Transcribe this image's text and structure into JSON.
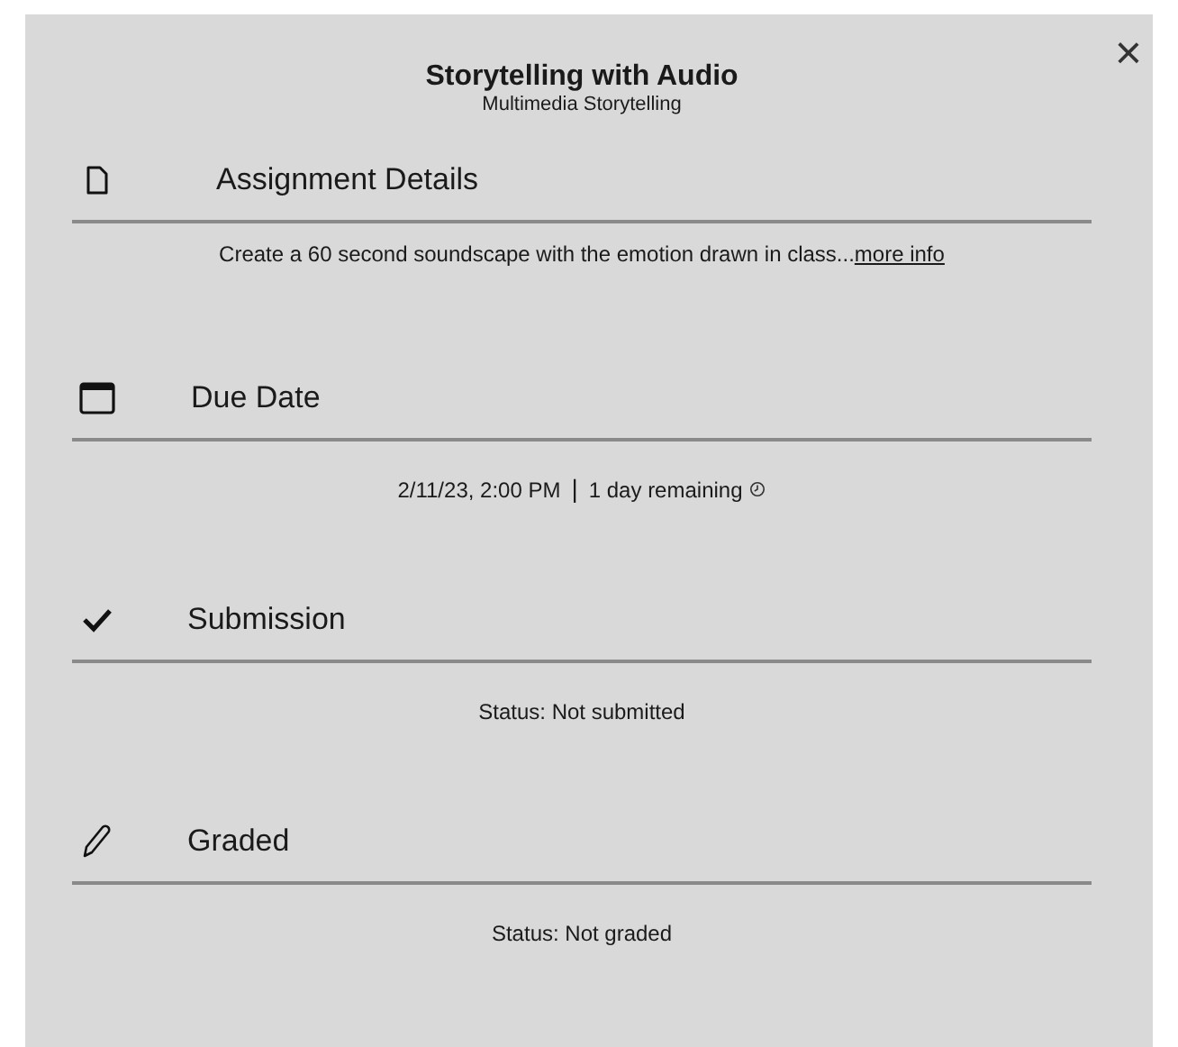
{
  "dialog": {
    "title": "Storytelling with Audio",
    "subtitle": "Multimedia Storytelling",
    "close": "×"
  },
  "sections": [
    {
      "kind": "document",
      "heading": "Assignment Details",
      "body": {
        "text": "Create a 60 second soundscape with the emotion drawn in class...",
        "link": "more info"
      }
    },
    {
      "kind": "calendar",
      "heading": "Due Date",
      "body": {
        "text": "2/11/23, 2:00 PM",
        "separator": "|",
        "remaining": "1 day remaining"
      }
    },
    {
      "kind": "check",
      "heading": "Submission",
      "body": {
        "text": "Status: Not submitted"
      }
    },
    {
      "kind": "pencil",
      "heading": "Graded",
      "body": {
        "text": "Status: Not graded"
      }
    }
  ]
}
